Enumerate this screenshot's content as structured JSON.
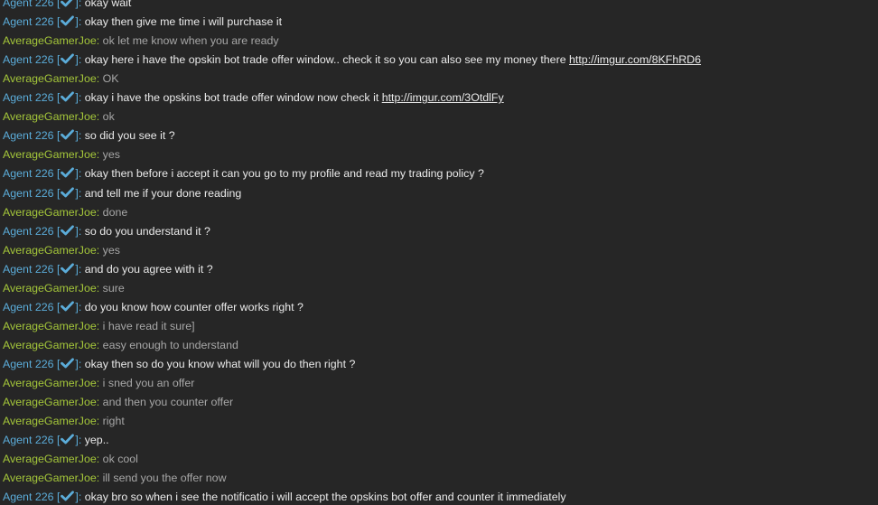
{
  "colors": {
    "background": "#262626",
    "agent_name": "#5bacd9",
    "gamer_name": "#a4c63a",
    "agent_text": "#eaeaea",
    "gamer_text": "#a7a7a7",
    "verified_check": "#5bacd9"
  },
  "names": {
    "agent_prefix": "Agent 226 [",
    "agent_suffix": "]: ",
    "gamer": "AverageGamerJoe: "
  },
  "messages": [
    {
      "from": "agent",
      "text": "okay wait"
    },
    {
      "from": "agent",
      "text": "okay then give me time i will purchase it"
    },
    {
      "from": "gamer",
      "text": "ok let me know when you are ready"
    },
    {
      "from": "agent",
      "text": "okay here i have the opskin bot trade offer window.. check it so you can also see my money there ",
      "link": "http://imgur.com/8KFhRD6"
    },
    {
      "from": "gamer",
      "text": "OK"
    },
    {
      "from": "agent",
      "text": "okay i have the opskins bot trade offer window now check it ",
      "link": "http://imgur.com/3OtdlFy"
    },
    {
      "from": "gamer",
      "text": "ok"
    },
    {
      "from": "agent",
      "text": "so did you see it ?"
    },
    {
      "from": "gamer",
      "text": "yes"
    },
    {
      "from": "agent",
      "text": "okay then before i accept it can you go to my profile and read my trading policy ?"
    },
    {
      "from": "agent",
      "text": "and tell me if your done reading"
    },
    {
      "from": "gamer",
      "text": "done"
    },
    {
      "from": "agent",
      "text": "so do you understand it ?"
    },
    {
      "from": "gamer",
      "text": "yes"
    },
    {
      "from": "agent",
      "text": "and do you agree with it ?"
    },
    {
      "from": "gamer",
      "text": "sure"
    },
    {
      "from": "agent",
      "text": "do you know how counter offer works right ?"
    },
    {
      "from": "gamer",
      "text": "i have read it sure]"
    },
    {
      "from": "gamer",
      "text": "easy enough to understand"
    },
    {
      "from": "agent",
      "text": "okay then so do you know  what will you do then right ?"
    },
    {
      "from": "gamer",
      "text": "i sned you an offer"
    },
    {
      "from": "gamer",
      "text": "and then you counter offer"
    },
    {
      "from": "gamer",
      "text": "right"
    },
    {
      "from": "agent",
      "text": "yep.."
    },
    {
      "from": "gamer",
      "text": "ok cool"
    },
    {
      "from": "gamer",
      "text": "ill send you the offer now"
    },
    {
      "from": "agent",
      "text": "okay bro so when i see the notificatio i will accept the opskins bot offer and counter it immediately"
    }
  ]
}
